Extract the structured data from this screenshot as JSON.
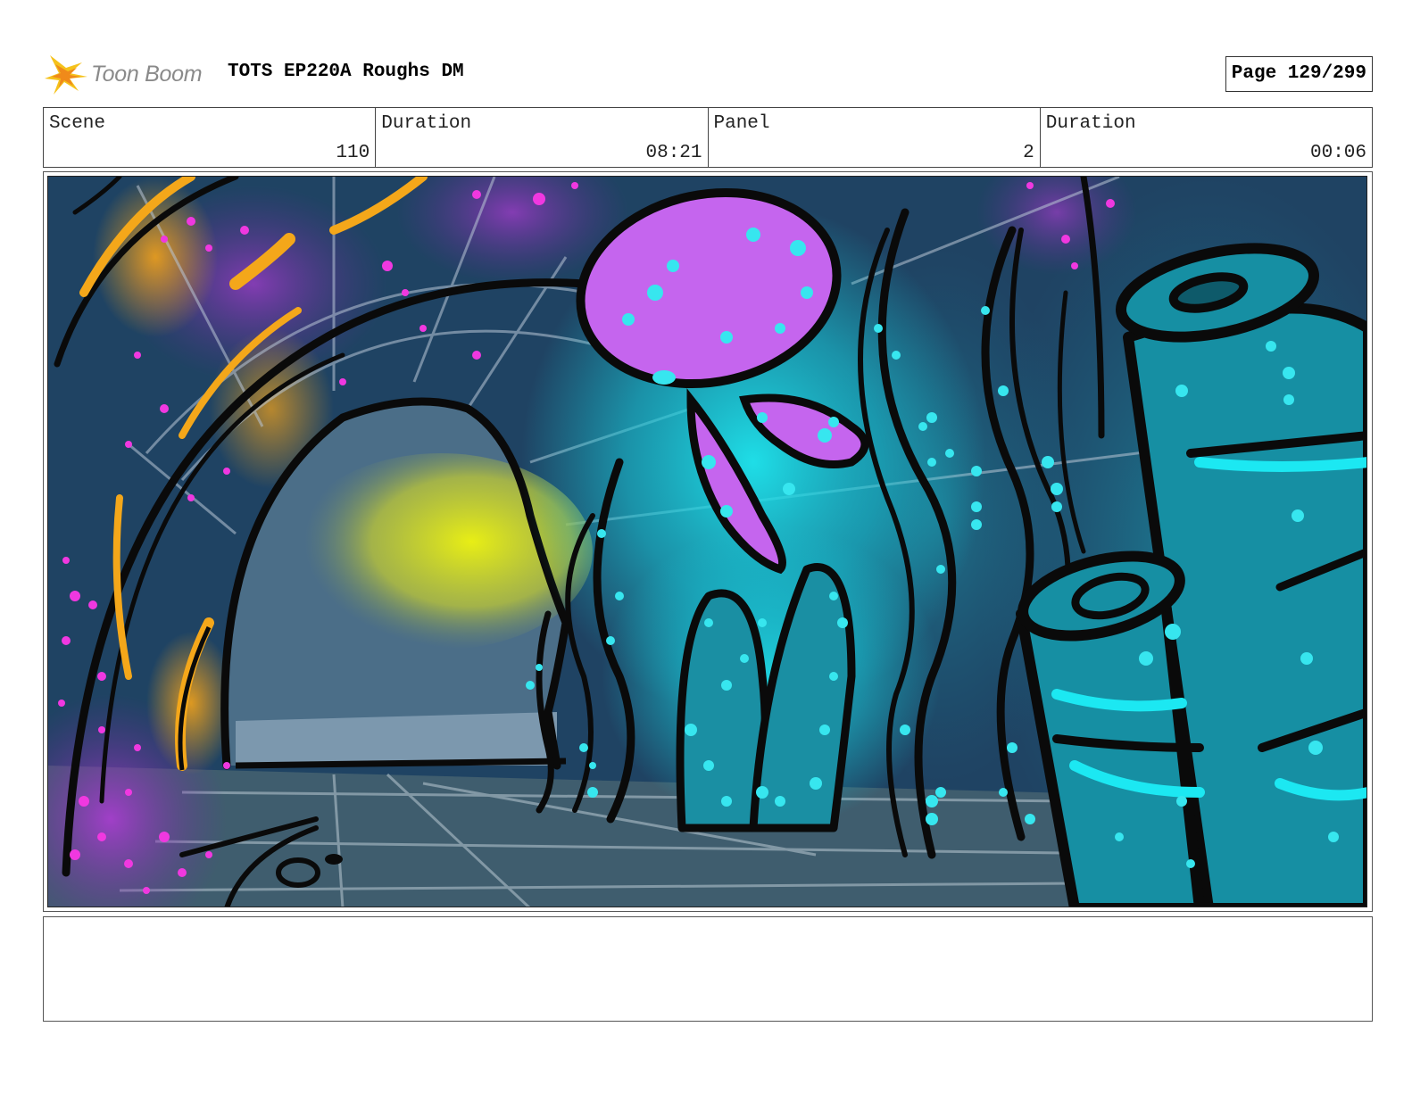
{
  "header": {
    "logo_text": "Toon Boom",
    "title": "TOTS EP220A Roughs DM",
    "page": "Page 129/299"
  },
  "info": [
    {
      "label": "Scene",
      "value": "110"
    },
    {
      "label": "Duration",
      "value": "08:21"
    },
    {
      "label": "Panel",
      "value": "2"
    },
    {
      "label": "Duration",
      "value": "00:06"
    }
  ],
  "panel": {
    "icon": "underwater-cave-jellyfish-sketch"
  },
  "notes": {
    "text": ""
  }
}
